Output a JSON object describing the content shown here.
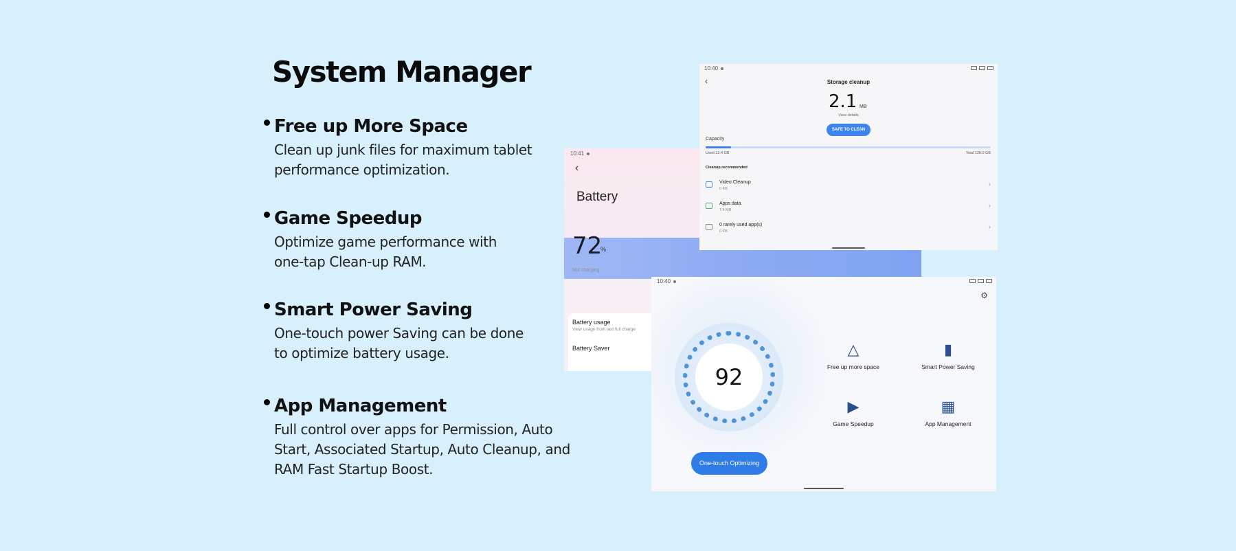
{
  "page": {
    "title": "System Manager",
    "features": [
      {
        "heading": "Free up More Space",
        "desc": "Clean up junk files for maximum tablet\nperformance optimization."
      },
      {
        "heading": "Game Speedup",
        "desc": "Optimize game performance with\none-tap Clean-up RAM."
      },
      {
        "heading": "Smart Power Saving",
        "desc": "One-touch power Saving can be done\nto optimize battery usage."
      },
      {
        "heading": "App Management",
        "desc": "Full control over apps for Permission, Auto\nStart, Associated Startup, Auto Cleanup, and\nRAM Fast Startup Boost."
      }
    ]
  },
  "battery_screen": {
    "time": "10:41",
    "title": "Battery",
    "percent": "72",
    "percent_unit": "%",
    "status": "Not charging",
    "usage_label": "Battery usage",
    "usage_sub": "View usage from last full charge",
    "saver_label": "Battery Saver"
  },
  "storage_screen": {
    "time": "10:40",
    "title": "Storage cleanup",
    "amount": "2.1",
    "unit": "MB",
    "view_details": "View details",
    "clean_button": "SAFE TO CLEAN",
    "capacity_label": "Capacity",
    "capacity_used_fraction": 0.09,
    "used": "Used 13.4 GB",
    "total": "Total 128.0 GB",
    "recommended": "Cleanup recommended",
    "rows": [
      {
        "name": "Video Cleanup",
        "size": "0 KB",
        "color": "#3d84f0"
      },
      {
        "name": "Apps data",
        "size": "7.4 MB",
        "color": "#3cb371"
      },
      {
        "name": "0 rarely used app(s)",
        "size": "0 KB",
        "color": "#888888"
      }
    ]
  },
  "main_screen": {
    "time": "10:40",
    "score": "92",
    "optimize_button": "One-touch Optimizing",
    "tools": [
      {
        "label": "Free up more space",
        "icon": "broom-icon"
      },
      {
        "label": "Smart Power Saving",
        "icon": "battery-icon"
      },
      {
        "label": "Game Speedup",
        "icon": "gamepad-icon"
      },
      {
        "label": "App Management",
        "icon": "apps-icon"
      }
    ]
  }
}
